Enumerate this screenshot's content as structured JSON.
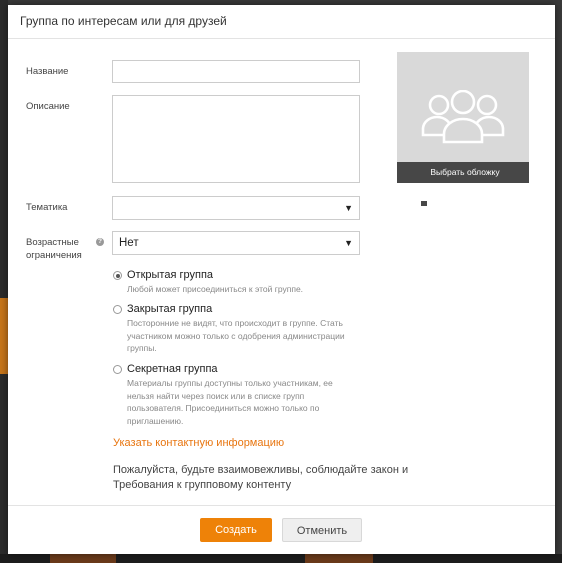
{
  "dialog": {
    "title": "Группа по интересам или для друзей"
  },
  "form": {
    "name_label": "Название",
    "name_value": "",
    "description_label": "Описание",
    "description_value": "",
    "topic_label": "Тематика",
    "topic_selected": "",
    "age_label_line1": "Возрастные",
    "age_label_line2": "ограничения",
    "age_selected": "Нет",
    "help_glyph": "?"
  },
  "cover": {
    "button_label": "Выбрать обложку",
    "placeholder_icon": "group-users-icon"
  },
  "group_types": [
    {
      "title": "Открытая группа",
      "description": "Любой может присоединиться к этой группе.",
      "selected": true
    },
    {
      "title": "Закрытая группа",
      "description": "Посторонние не видят, что происходит в группе. Стать участником можно только с одобрения администрации группы.",
      "selected": false
    },
    {
      "title": "Секретная группа",
      "description": "Материалы группы доступны только участникам, ее нельзя найти через поиск или в списке групп пользователя. Присоединиться можно только по приглашению.",
      "selected": false
    }
  ],
  "contact_link": "Указать контактную информацию",
  "notice": "Пожалуйста, будьте взаимовежливы, соблюдайте закон и Требования к групповому контенту",
  "footer": {
    "create_label": "Создать",
    "cancel_label": "Отменить"
  },
  "colors": {
    "accent": "#ee8208",
    "link": "#e8750f",
    "cover_bg": "#d9d9d9",
    "cover_bar": "#474747"
  }
}
